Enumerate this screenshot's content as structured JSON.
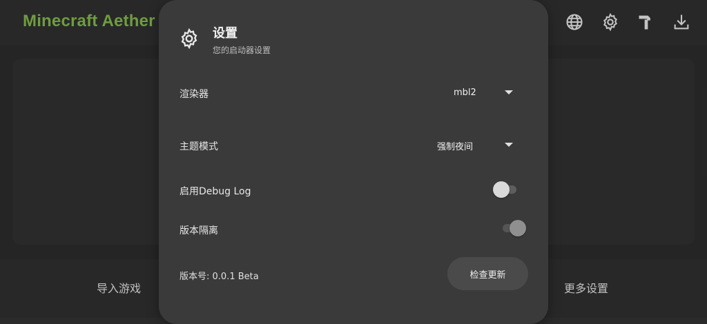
{
  "app": {
    "title": "Minecraft Aether L"
  },
  "bottom_nav": {
    "import_label": "导入游戏",
    "more_label": "更多设置"
  },
  "dialog": {
    "title": "设置",
    "subtitle": "您的启动器设置",
    "renderer": {
      "label": "渲染器",
      "value": "mbl2"
    },
    "theme": {
      "label": "主题模式",
      "value": "强制夜间"
    },
    "debug_log": {
      "label": "启用Debug Log",
      "enabled": false
    },
    "version_isolation": {
      "label": "版本隔离",
      "enabled": true
    },
    "version": {
      "text": "版本号: 0.0.1 Beta"
    },
    "check_update_label": "检查更新"
  },
  "colors": {
    "title_green": "#7fb24a",
    "dialog_bg": "#3a3a3a",
    "button_bg": "#4a4a4a",
    "switch_off_thumb": "#d9d9d9",
    "switch_on_thumb": "#8f8f8f"
  }
}
